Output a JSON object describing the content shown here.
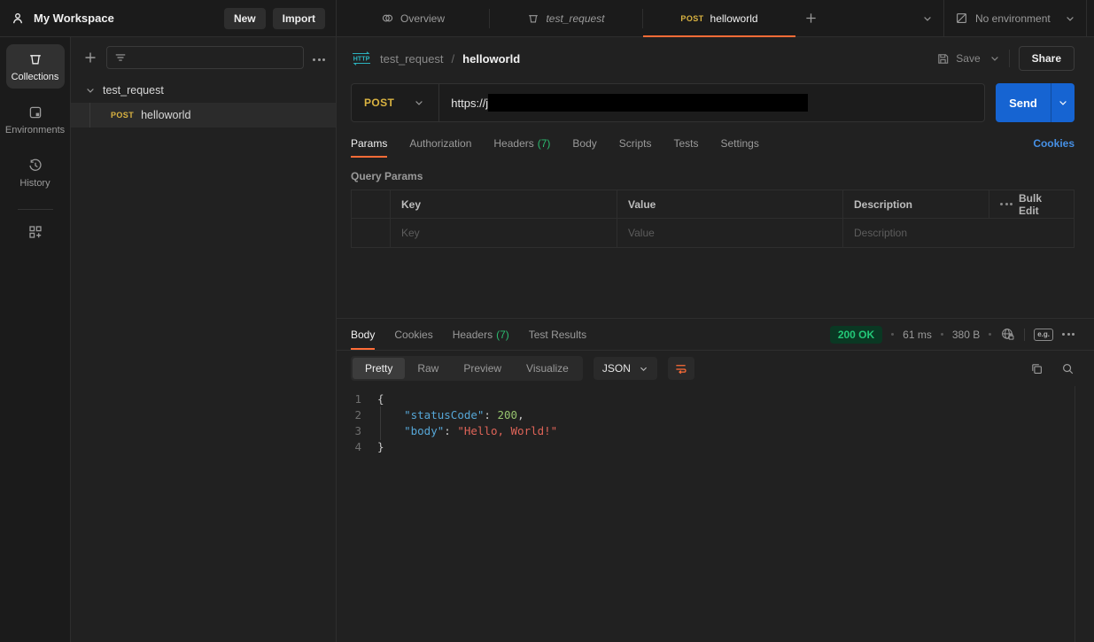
{
  "colors": {
    "accent": "#ff6c37",
    "method-post": "#dab341",
    "send-blue": "#1664d2",
    "link-blue": "#4690e5",
    "count-green": "#2cbb70",
    "status-green": "#23c878",
    "status-green-bg": "#0a3823",
    "http-teal": "#2bb3bf"
  },
  "topbar": {
    "workspace_label": "My Workspace",
    "new_button": "New",
    "import_button": "Import",
    "tabs": [
      {
        "label": "Overview"
      },
      {
        "label": "test_request"
      },
      {
        "method": "POST",
        "label": "helloworld"
      }
    ],
    "environment_label": "No environment"
  },
  "rail": {
    "collections_label": "Collections",
    "environments_label": "Environments",
    "history_label": "History"
  },
  "sidebar": {
    "collection_name": "test_request",
    "request": {
      "method": "POST",
      "name": "helloworld"
    }
  },
  "request": {
    "breadcrumb": {
      "collection": "test_request",
      "separator": "/",
      "name": "helloworld"
    },
    "save_label": "Save",
    "share_label": "Share",
    "method": "POST",
    "url_visible": "https://j",
    "send_label": "Send",
    "tabs": [
      "Params",
      "Authorization",
      "Headers",
      "Body",
      "Scripts",
      "Tests",
      "Settings"
    ],
    "headers_count": "(7)",
    "cookies_link": "Cookies",
    "query_params": {
      "title": "Query Params",
      "col_key": "Key",
      "col_value": "Value",
      "col_description": "Description",
      "bulk_edit_label": "Bulk Edit",
      "placeholder_key": "Key",
      "placeholder_value": "Value",
      "placeholder_description": "Description"
    }
  },
  "response": {
    "tabs": [
      "Body",
      "Cookies",
      "Headers",
      "Test Results"
    ],
    "headers_count": "(7)",
    "status_badge": "200 OK",
    "time": "61 ms",
    "size": "380 B",
    "example_icon_label": "e.g.",
    "view_tabs": [
      "Pretty",
      "Raw",
      "Preview",
      "Visualize"
    ],
    "format_selected": "JSON",
    "code": {
      "lines": [
        {
          "num": "1",
          "guide": false,
          "tokens": [
            {
              "c": "punct",
              "t": "{"
            }
          ]
        },
        {
          "num": "2",
          "guide": true,
          "tokens": [
            {
              "c": "ws",
              "t": "    "
            },
            {
              "c": "key",
              "t": "\"statusCode\""
            },
            {
              "c": "punct",
              "t": ": "
            },
            {
              "c": "num",
              "t": "200"
            },
            {
              "c": "punct",
              "t": ","
            }
          ]
        },
        {
          "num": "3",
          "guide": true,
          "tokens": [
            {
              "c": "ws",
              "t": "    "
            },
            {
              "c": "key",
              "t": "\"body\""
            },
            {
              "c": "punct",
              "t": ": "
            },
            {
              "c": "str",
              "t": "\"Hello, World!\""
            }
          ]
        },
        {
          "num": "4",
          "guide": false,
          "tokens": [
            {
              "c": "punct",
              "t": "}"
            }
          ]
        }
      ]
    }
  }
}
